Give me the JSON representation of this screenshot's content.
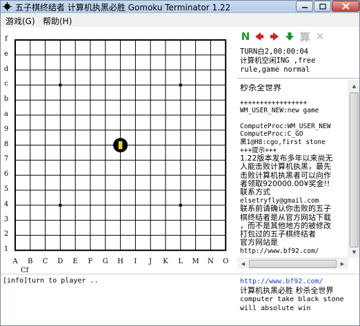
{
  "window": {
    "title": "五子棋终结者 计算机执黑必胜 Gomoku Terminator 1.22",
    "app_icon": "gomoku-stone-icon",
    "controls": [
      "minimize-icon",
      "maximize-icon",
      "close-icon"
    ]
  },
  "menu": {
    "game": "游戏(G)",
    "help": "帮助(H)"
  },
  "board": {
    "size": 15,
    "ranks": [
      "f",
      "e",
      "d",
      "c",
      "b",
      "a",
      "9",
      "8",
      "7",
      "6",
      "5",
      "4",
      "3",
      "2",
      "1"
    ],
    "files": [
      "A",
      "B",
      "C",
      "D",
      "E",
      "F",
      "G",
      "H",
      "I",
      "J",
      "K",
      "L",
      "M",
      "N",
      "O"
    ],
    "corner_label": "Cf",
    "star_points": [
      [
        "D",
        "c"
      ],
      [
        "L",
        "c"
      ],
      [
        "D",
        "4"
      ],
      [
        "L",
        "4"
      ]
    ],
    "stones": [
      {
        "file": "H",
        "rank": "8",
        "color": "black",
        "last_move": true
      }
    ],
    "colors": {
      "line": "#000000",
      "stone": "#000000",
      "last_move_marker": "#f2d31a"
    }
  },
  "toolbar": {
    "buttons": [
      {
        "name": "new-game-button",
        "glyph": "N",
        "icon": "new-game-icon",
        "color": "#1a9a2a"
      },
      {
        "name": "previous-move-button",
        "icon": "arrow-left-icon",
        "color": "#d42020"
      },
      {
        "name": "next-move-button",
        "icon": "arrow-right-icon",
        "color": "#d42020"
      },
      {
        "name": "download-button",
        "icon": "arrow-down-icon",
        "color": "#1a9a2a"
      },
      {
        "name": "compute-button",
        "glyph": "算",
        "icon": "compute-icon",
        "color": "#b9b9b9"
      },
      {
        "name": "cancel-button",
        "glyph": "✕",
        "icon": "cancel-icon",
        "color": "#b9b9b9"
      }
    ]
  },
  "status": {
    "line1": "TURN白2,00:00:04",
    "line2": "计算机空闲ING ,free",
    "line3": "rule,game normal"
  },
  "log": {
    "title": "秒杀全世界",
    "lines": [
      {
        "text": "+++++++++++++++++",
        "cn": false
      },
      {
        "text": "WM_USER_NEW:new game",
        "cn": false
      },
      {
        "text": "",
        "cn": false
      },
      {
        "text": "ComputeProc:WM_USER_NEW",
        "cn": false
      },
      {
        "text": "ComputeProc:C_GO",
        "cn": false
      },
      {
        "text": "黑1@H8:cgo,first stone",
        "cn": false
      },
      {
        "text": "+++提示+++",
        "cn": false
      },
      {
        "text": "1.22版本发布多年以来尚无",
        "cn": true
      },
      {
        "text": "人能击败计算机执黑，最先",
        "cn": true
      },
      {
        "text": "击败计算机执黑者可以向作",
        "cn": true
      },
      {
        "text": "者领取920000.00¥奖金!!",
        "cn": true
      },
      {
        "text": "联系方式",
        "cn": true
      },
      {
        "text": "elsetryfly@gmail.com",
        "cn": false
      },
      {
        "text": "联系前请确认你击败的五子",
        "cn": true
      },
      {
        "text": "棋终结者是从官方网站下载",
        "cn": true
      },
      {
        "text": "，而不是其他地方的被修改",
        "cn": true
      },
      {
        "text": "打包过的五子棋终结者",
        "cn": true
      },
      {
        "text": "官方网站是",
        "cn": true
      },
      {
        "text": "http://www.bf92.com/",
        "cn": false
      }
    ]
  },
  "info": {
    "message": "[info]turn to player .."
  },
  "promo": {
    "link": "http://www.bf92.com/",
    "line1": "计算机执黑必胜 秒杀全世界",
    "line2": "computer take black stone",
    "line3": "will absolute win"
  }
}
